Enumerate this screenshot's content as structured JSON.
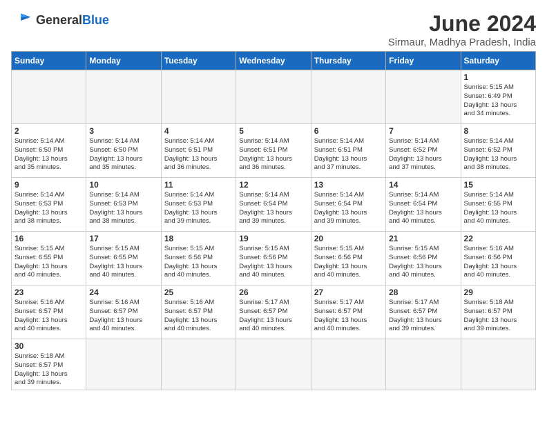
{
  "header": {
    "logo_general": "General",
    "logo_blue": "Blue",
    "title": "June 2024",
    "subtitle": "Sirmaur, Madhya Pradesh, India"
  },
  "weekdays": [
    "Sunday",
    "Monday",
    "Tuesday",
    "Wednesday",
    "Thursday",
    "Friday",
    "Saturday"
  ],
  "weeks": [
    [
      {
        "day": "",
        "info": ""
      },
      {
        "day": "",
        "info": ""
      },
      {
        "day": "",
        "info": ""
      },
      {
        "day": "",
        "info": ""
      },
      {
        "day": "",
        "info": ""
      },
      {
        "day": "",
        "info": ""
      },
      {
        "day": "1",
        "info": "Sunrise: 5:15 AM\nSunset: 6:49 PM\nDaylight: 13 hours\nand 34 minutes."
      }
    ],
    [
      {
        "day": "2",
        "info": "Sunrise: 5:14 AM\nSunset: 6:50 PM\nDaylight: 13 hours\nand 35 minutes."
      },
      {
        "day": "3",
        "info": "Sunrise: 5:14 AM\nSunset: 6:50 PM\nDaylight: 13 hours\nand 35 minutes."
      },
      {
        "day": "4",
        "info": "Sunrise: 5:14 AM\nSunset: 6:51 PM\nDaylight: 13 hours\nand 36 minutes."
      },
      {
        "day": "5",
        "info": "Sunrise: 5:14 AM\nSunset: 6:51 PM\nDaylight: 13 hours\nand 36 minutes."
      },
      {
        "day": "6",
        "info": "Sunrise: 5:14 AM\nSunset: 6:51 PM\nDaylight: 13 hours\nand 37 minutes."
      },
      {
        "day": "7",
        "info": "Sunrise: 5:14 AM\nSunset: 6:52 PM\nDaylight: 13 hours\nand 37 minutes."
      },
      {
        "day": "8",
        "info": "Sunrise: 5:14 AM\nSunset: 6:52 PM\nDaylight: 13 hours\nand 38 minutes."
      }
    ],
    [
      {
        "day": "9",
        "info": "Sunrise: 5:14 AM\nSunset: 6:53 PM\nDaylight: 13 hours\nand 38 minutes."
      },
      {
        "day": "10",
        "info": "Sunrise: 5:14 AM\nSunset: 6:53 PM\nDaylight: 13 hours\nand 38 minutes."
      },
      {
        "day": "11",
        "info": "Sunrise: 5:14 AM\nSunset: 6:53 PM\nDaylight: 13 hours\nand 39 minutes."
      },
      {
        "day": "12",
        "info": "Sunrise: 5:14 AM\nSunset: 6:54 PM\nDaylight: 13 hours\nand 39 minutes."
      },
      {
        "day": "13",
        "info": "Sunrise: 5:14 AM\nSunset: 6:54 PM\nDaylight: 13 hours\nand 39 minutes."
      },
      {
        "day": "14",
        "info": "Sunrise: 5:14 AM\nSunset: 6:54 PM\nDaylight: 13 hours\nand 40 minutes."
      },
      {
        "day": "15",
        "info": "Sunrise: 5:14 AM\nSunset: 6:55 PM\nDaylight: 13 hours\nand 40 minutes."
      }
    ],
    [
      {
        "day": "16",
        "info": "Sunrise: 5:15 AM\nSunset: 6:55 PM\nDaylight: 13 hours\nand 40 minutes."
      },
      {
        "day": "17",
        "info": "Sunrise: 5:15 AM\nSunset: 6:55 PM\nDaylight: 13 hours\nand 40 minutes."
      },
      {
        "day": "18",
        "info": "Sunrise: 5:15 AM\nSunset: 6:56 PM\nDaylight: 13 hours\nand 40 minutes."
      },
      {
        "day": "19",
        "info": "Sunrise: 5:15 AM\nSunset: 6:56 PM\nDaylight: 13 hours\nand 40 minutes."
      },
      {
        "day": "20",
        "info": "Sunrise: 5:15 AM\nSunset: 6:56 PM\nDaylight: 13 hours\nand 40 minutes."
      },
      {
        "day": "21",
        "info": "Sunrise: 5:15 AM\nSunset: 6:56 PM\nDaylight: 13 hours\nand 40 minutes."
      },
      {
        "day": "22",
        "info": "Sunrise: 5:16 AM\nSunset: 6:56 PM\nDaylight: 13 hours\nand 40 minutes."
      }
    ],
    [
      {
        "day": "23",
        "info": "Sunrise: 5:16 AM\nSunset: 6:57 PM\nDaylight: 13 hours\nand 40 minutes."
      },
      {
        "day": "24",
        "info": "Sunrise: 5:16 AM\nSunset: 6:57 PM\nDaylight: 13 hours\nand 40 minutes."
      },
      {
        "day": "25",
        "info": "Sunrise: 5:16 AM\nSunset: 6:57 PM\nDaylight: 13 hours\nand 40 minutes."
      },
      {
        "day": "26",
        "info": "Sunrise: 5:17 AM\nSunset: 6:57 PM\nDaylight: 13 hours\nand 40 minutes."
      },
      {
        "day": "27",
        "info": "Sunrise: 5:17 AM\nSunset: 6:57 PM\nDaylight: 13 hours\nand 40 minutes."
      },
      {
        "day": "28",
        "info": "Sunrise: 5:17 AM\nSunset: 6:57 PM\nDaylight: 13 hours\nand 39 minutes."
      },
      {
        "day": "29",
        "info": "Sunrise: 5:18 AM\nSunset: 6:57 PM\nDaylight: 13 hours\nand 39 minutes."
      }
    ],
    [
      {
        "day": "30",
        "info": "Sunrise: 5:18 AM\nSunset: 6:57 PM\nDaylight: 13 hours\nand 39 minutes."
      },
      {
        "day": "",
        "info": ""
      },
      {
        "day": "",
        "info": ""
      },
      {
        "day": "",
        "info": ""
      },
      {
        "day": "",
        "info": ""
      },
      {
        "day": "",
        "info": ""
      },
      {
        "day": "",
        "info": ""
      }
    ]
  ]
}
